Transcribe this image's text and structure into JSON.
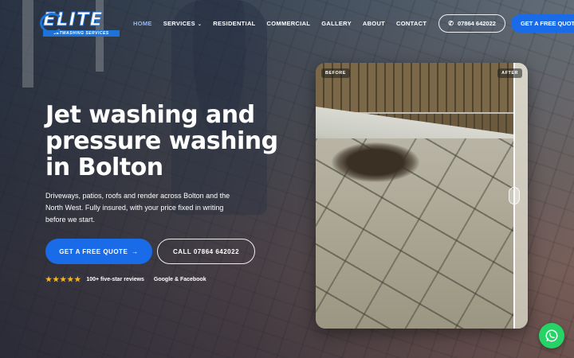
{
  "brand": {
    "logo_word": "ELITE",
    "logo_sub": "JETWASHING SERVICES",
    "accent": "#1a6be8"
  },
  "nav": {
    "items": [
      {
        "label": "HOME",
        "active": true
      },
      {
        "label": "SERVICES",
        "has_dropdown": true
      },
      {
        "label": "RESIDENTIAL"
      },
      {
        "label": "COMMERCIAL"
      },
      {
        "label": "GALLERY"
      },
      {
        "label": "ABOUT"
      },
      {
        "label": "CONTACT"
      }
    ],
    "phone_label": "07864 642022",
    "quote_label": "GET A FREE QUOTE"
  },
  "hero": {
    "title": "Jet washing and pressure washing in Bolton",
    "subtitle": "Driveways, patios, roofs and render across Bolton and the North West. Fully insured, with your price fixed in writing before we start.",
    "cta_quote": "GET A FREE QUOTE",
    "cta_call": "CALL 07864 642022",
    "stars": 5,
    "reviews_text": "100+ five-star reviews",
    "reviews_source": "Google & Facebook"
  },
  "before_after": {
    "before_label": "BEFORE",
    "after_label": "AFTER",
    "slider_position": 0.93
  },
  "icons": {
    "phone": "phone-icon",
    "arrow": "arrow-right-icon",
    "star": "star-icon",
    "whatsapp": "whatsapp-icon",
    "chevron": "chevron-down-icon"
  }
}
